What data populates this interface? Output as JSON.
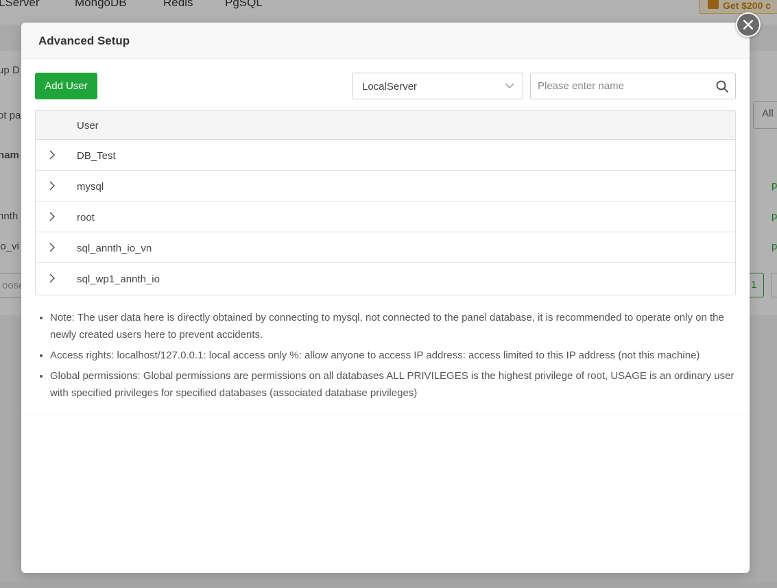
{
  "background": {
    "tabs": [
      "LServer",
      "MongoDB",
      "Redis",
      "PgSQL"
    ],
    "promo_label": "Get $200 c",
    "fragments": [
      "up D",
      "ot pas",
      "nam",
      "nnth",
      "io_vi",
      "oose",
      "All"
    ],
    "green_marks": [
      "p",
      "p",
      "p"
    ],
    "page_number": "1"
  },
  "modal": {
    "title": "Advanced Setup",
    "add_user_label": "Add User",
    "server_select": {
      "value": "LocalServer"
    },
    "search": {
      "placeholder": "Please enter name",
      "value": ""
    },
    "table": {
      "header": "User",
      "rows": [
        "DB_Test",
        "mysql",
        "root",
        "sql_annth_io_vn",
        "sql_wp1_annth_io"
      ]
    },
    "notes": [
      "Note: The user data here is directly obtained by connecting to mysql, not connected to the panel database, it is recommended to operate only on the newly created users here to prevent accidents.",
      "Access rights: localhost/127.0.0.1: local access only %: allow anyone to access IP address: access limited to this IP address (not this machine)",
      "Global permissions: Global permissions are permissions on all databases ALL PRIVILEGES is the highest privilege of root, USAGE is an ordinary user with specified privileges for specified databases (associated database privileges)"
    ]
  },
  "colors": {
    "accent_green": "#20a53a",
    "overlay": "rgba(0,0,0,0.30)",
    "promo": "#c8820a"
  },
  "icons": [
    "close-icon",
    "chevron-down-icon",
    "search-icon",
    "chevron-right-icon"
  ]
}
